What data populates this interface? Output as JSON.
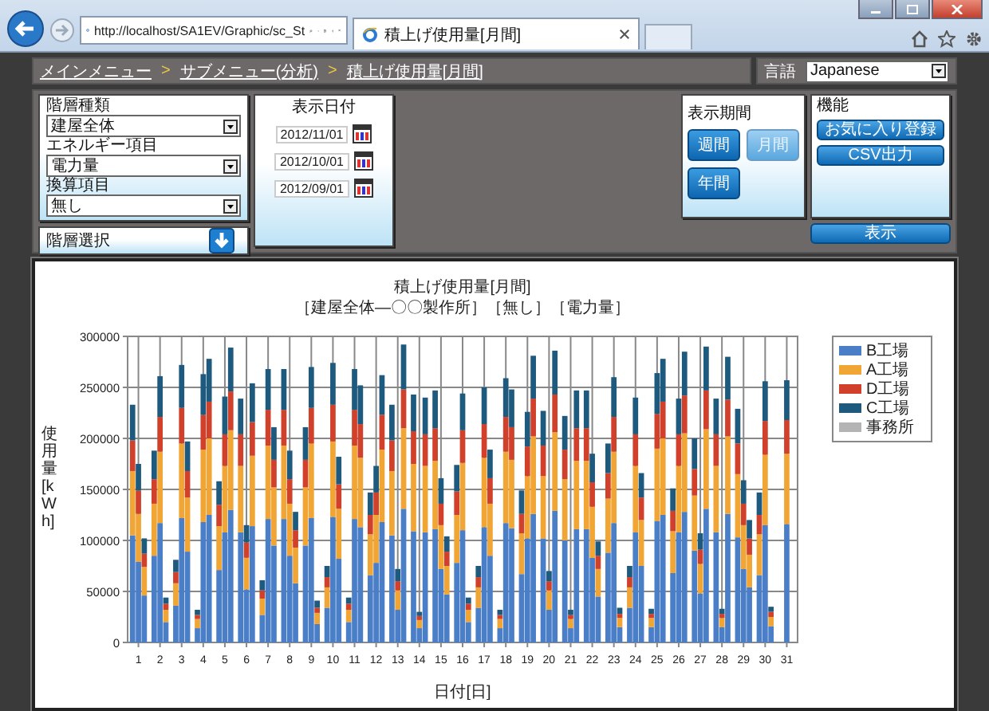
{
  "browser": {
    "url": "http://localhost/SA1EV/Graphic/sc_St",
    "tab_title": "積上げ使用量[月間]"
  },
  "breadcrumb": {
    "separator": ">",
    "items": [
      "メインメニュー",
      "サブメニュー(分析)",
      "積上げ使用量[月間]"
    ]
  },
  "language": {
    "label": "言語",
    "value": "Japanese"
  },
  "filters": [
    {
      "label": "階層種類",
      "value": "建屋全体"
    },
    {
      "label": "エネルギー項目",
      "value": "電力量"
    },
    {
      "label": "換算項目",
      "value": "無し"
    }
  ],
  "hierarchy_select": {
    "label": "階層選択"
  },
  "dates": {
    "label": "表示日付",
    "values": [
      "2012/11/01",
      "2012/10/01",
      "2012/09/01"
    ]
  },
  "period": {
    "label": "表示期間",
    "options": [
      {
        "label": "週間",
        "selected": false
      },
      {
        "label": "月間",
        "selected": true
      },
      {
        "label": "年間",
        "selected": false
      }
    ]
  },
  "functions": {
    "label": "機能",
    "buttons": [
      "お気に入り登録",
      "CSV出力"
    ]
  },
  "show_button": "表示",
  "chart": {
    "chart_data": {
      "type": "bar",
      "title": "積上げ使用量[月間]",
      "subtitle": "［建屋全体―〇〇製作所］［無し］［電力量］",
      "xlabel": "日付[日]",
      "ylabel": "使用量[kWh]",
      "stacked": true,
      "grid": true,
      "legend": "right",
      "xlim": [
        0.5,
        31.5
      ],
      "ylim": [
        0,
        300000
      ],
      "yticks": [
        0,
        50000,
        100000,
        150000,
        200000,
        250000,
        300000
      ],
      "xticks": [
        1,
        2,
        3,
        4,
        5,
        6,
        7,
        8,
        9,
        10,
        11,
        12,
        13,
        14,
        15,
        16,
        17,
        18,
        19,
        20,
        21,
        22,
        23,
        24,
        25,
        26,
        27,
        28,
        29,
        30,
        31
      ],
      "x": [
        0.73,
        1,
        1.27,
        1.73,
        2,
        2.27,
        2.73,
        3,
        3.27,
        3.73,
        4,
        4.27,
        4.73,
        5,
        5.27,
        5.73,
        6,
        6.27,
        6.73,
        7,
        7.27,
        7.73,
        8,
        8.27,
        8.73,
        9,
        9.27,
        9.73,
        10,
        10.27,
        10.73,
        11,
        11.27,
        11.73,
        12,
        12.27,
        12.73,
        13,
        13.27,
        13.73,
        14,
        14.27,
        14.73,
        15,
        15.27,
        15.73,
        16,
        16.27,
        16.73,
        17,
        17.27,
        17.73,
        18,
        18.27,
        18.73,
        19,
        19.27,
        19.73,
        20,
        20.27,
        20.73,
        21,
        21.27,
        21.73,
        22,
        22.27,
        22.73,
        23,
        23.27,
        23.73,
        24,
        24.27,
        24.73,
        25,
        25.27,
        25.73,
        26,
        26.27,
        26.73,
        27,
        27.27,
        27.73,
        28,
        28.27,
        28.73,
        29,
        29.27,
        29.73,
        30,
        30.27,
        31
      ],
      "series": [
        {
          "name": "B工場",
          "color": "#4a7fc8",
          "values": [
            105000,
            79000,
            46000,
            85000,
            117000,
            20000,
            36000,
            122000,
            89000,
            14000,
            118000,
            125000,
            71000,
            108000,
            130000,
            108000,
            52000,
            114000,
            27000,
            121000,
            95000,
            121000,
            85000,
            58000,
            95000,
            122000,
            18000,
            34000,
            123000,
            82000,
            20000,
            121000,
            113000,
            66000,
            78000,
            118000,
            105000,
            32000,
            131000,
            109000,
            14000,
            108000,
            111000,
            72000,
            47000,
            78000,
            110000,
            20000,
            34000,
            113000,
            85000,
            14000,
            117000,
            112000,
            67000,
            102000,
            126000,
            102000,
            32000,
            129000,
            100000,
            14000,
            111000,
            111000,
            83000,
            45000,
            88000,
            117000,
            15000,
            34000,
            108000,
            75000,
            15000,
            119000,
            125000,
            68000,
            108000,
            128000,
            90000,
            48000,
            131000,
            108000,
            15000,
            126000,
            103000,
            72000,
            54000,
            66000,
            115000,
            16000,
            116000
          ]
        },
        {
          "name": "A工場",
          "color": "#f0a535",
          "values": [
            63000,
            47000,
            28000,
            51000,
            70000,
            12000,
            22000,
            73000,
            53000,
            9000,
            71000,
            75000,
            43000,
            65000,
            78000,
            65000,
            31000,
            69000,
            16000,
            72000,
            57000,
            72000,
            51000,
            35000,
            57000,
            73000,
            11000,
            20000,
            74000,
            49000,
            12000,
            72000,
            68000,
            40000,
            47000,
            71000,
            63000,
            19000,
            79000,
            66000,
            8000,
            65000,
            67000,
            43000,
            28000,
            47000,
            66000,
            12000,
            20000,
            68000,
            51000,
            9000,
            70000,
            67000,
            40000,
            61000,
            76000,
            61000,
            19000,
            77000,
            60000,
            9000,
            67000,
            67000,
            50000,
            27000,
            53000,
            70000,
            9000,
            20000,
            65000,
            45000,
            9000,
            71000,
            75000,
            41000,
            65000,
            77000,
            54000,
            29000,
            78000,
            65000,
            9000,
            76000,
            62000,
            43000,
            32000,
            40000,
            69000,
            9000,
            69000
          ]
        },
        {
          "name": "D工場",
          "color": "#d0402a",
          "values": [
            30000,
            23000,
            13000,
            24000,
            34000,
            6000,
            11000,
            35000,
            26000,
            4000,
            34000,
            36000,
            21000,
            31000,
            38000,
            31000,
            15000,
            33000,
            8000,
            35000,
            27000,
            35000,
            24000,
            17000,
            27000,
            35000,
            5000,
            10000,
            36000,
            24000,
            6000,
            35000,
            33000,
            19000,
            22000,
            34000,
            30000,
            9000,
            38000,
            32000,
            4000,
            31000,
            32000,
            21000,
            14000,
            23000,
            32000,
            6000,
            10000,
            33000,
            25000,
            4000,
            34000,
            32000,
            19000,
            29000,
            37000,
            30000,
            9000,
            37000,
            29000,
            4000,
            32000,
            32000,
            24000,
            13000,
            25000,
            34000,
            4000,
            10000,
            31000,
            22000,
            4000,
            34000,
            36000,
            20000,
            31000,
            37000,
            26000,
            14000,
            38000,
            31000,
            4000,
            36000,
            30000,
            21000,
            16000,
            19000,
            33000,
            5000,
            33000
          ]
        },
        {
          "name": "C工場",
          "color": "#1d5a7e",
          "values": [
            35000,
            26000,
            15000,
            28000,
            40000,
            6000,
            12000,
            42000,
            29000,
            5000,
            40000,
            42000,
            23000,
            37000,
            43000,
            35000,
            17000,
            38000,
            10000,
            40000,
            32000,
            40000,
            28000,
            18000,
            32000,
            40000,
            7000,
            11000,
            41000,
            27000,
            6000,
            40000,
            38000,
            22000,
            26000,
            39000,
            35000,
            12000,
            44000,
            36000,
            4000,
            36000,
            37000,
            25000,
            15000,
            26000,
            36000,
            6000,
            11000,
            36000,
            28000,
            5000,
            38000,
            37000,
            23000,
            34000,
            42000,
            34000,
            10000,
            43000,
            33000,
            5000,
            37000,
            37000,
            28000,
            14000,
            29000,
            39000,
            6000,
            11000,
            36000,
            24000,
            5000,
            40000,
            42000,
            22000,
            35000,
            43000,
            30000,
            16000,
            43000,
            35000,
            5000,
            42000,
            34000,
            23000,
            18000,
            22000,
            39000,
            5000,
            39000
          ]
        },
        {
          "name": "事務所",
          "color": "#b4b4b4",
          "values": [
            0,
            0,
            0,
            0,
            0,
            0,
            0,
            0,
            0,
            0,
            0,
            0,
            0,
            0,
            0,
            0,
            0,
            0,
            0,
            0,
            0,
            0,
            0,
            0,
            0,
            0,
            0,
            0,
            0,
            0,
            0,
            0,
            0,
            0,
            0,
            0,
            0,
            0,
            0,
            0,
            0,
            0,
            0,
            0,
            0,
            0,
            0,
            0,
            0,
            0,
            0,
            0,
            0,
            0,
            0,
            0,
            0,
            0,
            0,
            0,
            0,
            0,
            0,
            0,
            0,
            0,
            0,
            0,
            0,
            0,
            0,
            0,
            0,
            0,
            0,
            0,
            0,
            0,
            0,
            0,
            0,
            0,
            0,
            0,
            0,
            0,
            0,
            0,
            0,
            0,
            0
          ]
        }
      ]
    }
  }
}
